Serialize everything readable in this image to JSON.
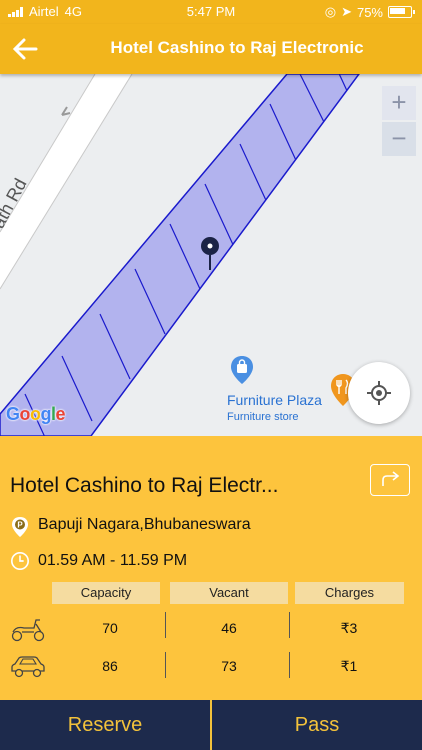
{
  "status": {
    "carrier": "Airtel",
    "network": "4G",
    "time": "5:47 PM",
    "battery": "75%"
  },
  "header": {
    "title": "Hotel Cashino to Raj Electronic",
    "back_icon": "back-arrow-icon"
  },
  "map": {
    "road_label": "ath Rd",
    "zoom_in": "+",
    "zoom_out": "−",
    "poi": {
      "name": "Furniture Plaza",
      "category": "Furniture store"
    },
    "attribution": "Google"
  },
  "info": {
    "place_name": "Hotel Cashino to Raj Electr...",
    "address": "Bapuji Nagara,Bhubaneswara",
    "hours": "01.59 AM - 11.59 PM",
    "columns": [
      "Capacity",
      "Vacant",
      "Charges"
    ],
    "rows": [
      {
        "vehicle": "scooter-icon",
        "capacity": "70",
        "vacant": "46",
        "charges": "₹3"
      },
      {
        "vehicle": "car-icon",
        "capacity": "86",
        "vacant": "73",
        "charges": "₹1"
      }
    ]
  },
  "actions": {
    "reserve": "Reserve",
    "pass": "Pass"
  },
  "colors": {
    "accent": "#fdc43d",
    "header": "#f2b51c",
    "button_bg": "#1d2a4c",
    "button_text": "#f3c23b"
  }
}
